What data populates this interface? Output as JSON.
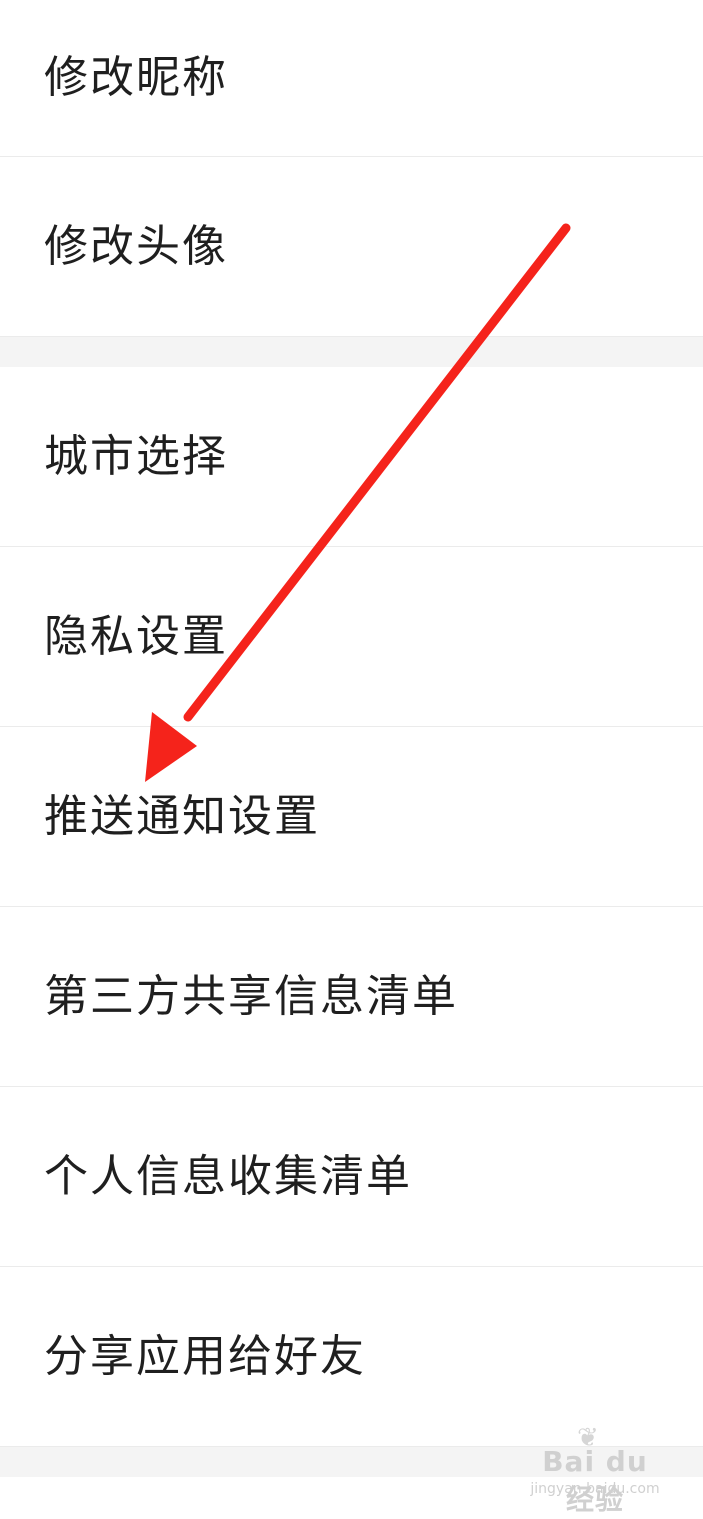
{
  "settings": {
    "items": [
      {
        "label": "修改昵称"
      },
      {
        "label": "修改头像"
      },
      {
        "label": "城市选择"
      },
      {
        "label": "隐私设置"
      },
      {
        "label": "推送通知设置"
      },
      {
        "label": "第三方共享信息清单"
      },
      {
        "label": "个人信息收集清单"
      },
      {
        "label": "分享应用给好友"
      }
    ]
  },
  "annotation": {
    "arrow_color": "#f5231b",
    "icon": "red-arrow-pointing-to-推送通知设置"
  },
  "watermark": {
    "brand": "Bai du 经验",
    "url": "jingyan.baidu.com"
  }
}
